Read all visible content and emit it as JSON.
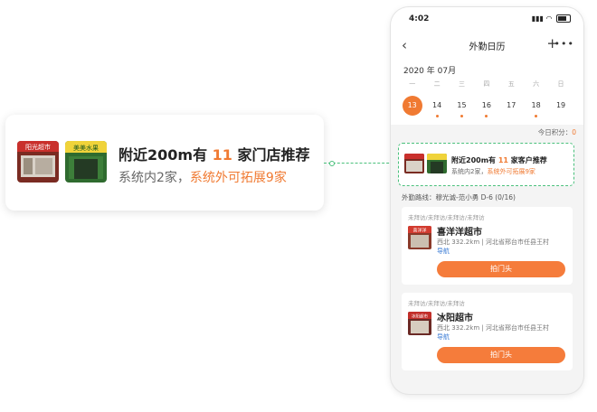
{
  "callout": {
    "title_pre": "附近200m有 ",
    "title_count": "11",
    "title_post": " 家门店推荐",
    "sub_in": "系统内2家，",
    "sub_out": "系统外可拓展9家",
    "shop1_sign": "阳光超市",
    "shop2_sign": "美美水果"
  },
  "status": {
    "time": "4:02"
  },
  "nav": {
    "title": "外勤日历"
  },
  "calendar": {
    "month": "2020 年 07月",
    "weekdays": [
      "一",
      "二",
      "三",
      "四",
      "五",
      "六",
      "日"
    ],
    "dates": [
      {
        "d": "13",
        "active": true,
        "mark": false
      },
      {
        "d": "14",
        "active": false,
        "mark": true
      },
      {
        "d": "15",
        "active": false,
        "mark": true
      },
      {
        "d": "16",
        "active": false,
        "mark": true
      },
      {
        "d": "17",
        "active": false,
        "mark": false
      },
      {
        "d": "18",
        "active": false,
        "mark": true
      },
      {
        "d": "19",
        "active": false,
        "mark": false
      }
    ]
  },
  "score": {
    "label": "今日积分：",
    "value": "0"
  },
  "recommend": {
    "title_pre": "附近200m有 ",
    "title_count": "11",
    "title_post": " 家客户推荐",
    "sub_in": "系统内2家，",
    "sub_out": "系统外可拓展9家"
  },
  "route": {
    "label": "外勤路线：穆光诚-范小勇 D-6 (0/16)"
  },
  "cards": [
    {
      "tags": "未拜访/未拜访/未拜访/未拜访",
      "name": "喜洋洋超市",
      "meta": "西北 332.2km | 河北省邢台市任县王村",
      "nav": "导航",
      "button": "拍门头",
      "sign": "喜洋洋"
    },
    {
      "tags": "未拜访/未拜访/未拜访",
      "name": "冰阳超市",
      "meta": "西北 332.2km | 河北省邢台市任县王村",
      "nav": "导航",
      "button": "拍门头",
      "sign": "冰阳超市"
    }
  ],
  "colors": {
    "accent": "#f07a32",
    "dashed": "#4ac07c",
    "link": "#3a7bd5"
  }
}
